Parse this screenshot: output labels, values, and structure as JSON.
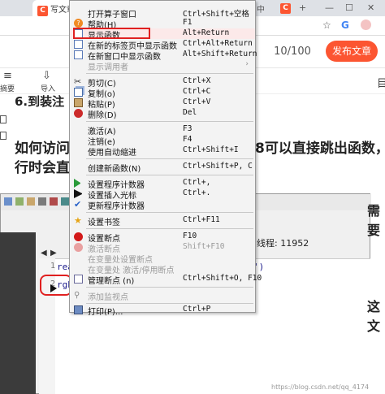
{
  "browser": {
    "tab_title": "写文章-",
    "tab_logo": "C",
    "tab_close": "×",
    "tab_fragment": "中",
    "tab2_logo": "C",
    "new_tab": "+",
    "win_min": "—",
    "win_max": "☐",
    "win_close": "✕",
    "star": "☆"
  },
  "editor": {
    "page_counter": "10/100",
    "publish_label": "发布文章",
    "toolbar_labels": [
      "摘要",
      "导入"
    ],
    "right_label": "目",
    "heading": "6.到装注",
    "paragraph_line1": "如何访问",
    "paragraph_line1_end": "8可以直接跳出函数，",
    "paragraph_line2": "行时会直",
    "edge_text_1": "需要",
    "edge_text_2": "这文"
  },
  "debugger": {
    "thread_label": "线程: 11952",
    "code_line_1": "rea",
    "code_line_1_end": "')",
    "code_line_2": "rgb",
    "line_number_1": "1",
    "line_number_2": "2"
  },
  "context_menu": {
    "items": [
      {
        "label": "打开算子窗口",
        "shortcut": "Ctrl+Shift+空格",
        "icon": "blank-icon",
        "enabled": true
      },
      {
        "label": "帮助(H)",
        "shortcut": "F1",
        "icon": "help-icon",
        "enabled": true
      },
      {
        "label": "显示函数",
        "shortcut": "Alt+Return",
        "icon": "document-icon",
        "enabled": true
      },
      {
        "label": "在新的标签页中显示函数",
        "shortcut": "Ctrl+Alt+Return",
        "icon": "document-icon",
        "enabled": true
      },
      {
        "label": "在新窗口中显示函数",
        "shortcut": "Alt+Shift+Return",
        "icon": "document-icon",
        "enabled": true
      },
      {
        "label": "显示调用者",
        "shortcut": "",
        "icon": "blank-icon",
        "enabled": false,
        "submenu_arrow": "›"
      },
      {
        "label": "剪切(C)",
        "shortcut": "Ctrl+X",
        "icon": "scissors-icon",
        "enabled": true
      },
      {
        "label": "复制(o)",
        "shortcut": "Ctrl+C",
        "icon": "copy-icon",
        "enabled": true
      },
      {
        "label": "粘贴(P)",
        "shortcut": "Ctrl+V",
        "icon": "paste-icon",
        "enabled": true
      },
      {
        "label": "删除(D)",
        "shortcut": "Del",
        "icon": "delete-icon",
        "enabled": true
      },
      {
        "label": "激活(A)",
        "shortcut": "F3",
        "icon": "blank-icon",
        "enabled": true
      },
      {
        "label": "注销(e)",
        "shortcut": "F4",
        "icon": "blank-icon",
        "enabled": true
      },
      {
        "label": "使用自动缩进",
        "shortcut": "Ctrl+Shift+I",
        "icon": "blank-icon",
        "enabled": true
      },
      {
        "label": "创建新函数(N)",
        "shortcut": "Ctrl+Shift+P, C",
        "icon": "blank-icon",
        "enabled": true
      },
      {
        "label": "设置程序计数器",
        "shortcut": "Ctrl+,",
        "icon": "green-arrow-icon",
        "enabled": true
      },
      {
        "label": "设置插入光标",
        "shortcut": "Ctrl+.",
        "icon": "black-arrow-icon",
        "enabled": true
      },
      {
        "label": "更新程序计数器",
        "shortcut": "",
        "icon": "checkmark-icon",
        "enabled": true
      },
      {
        "label": "设置书签",
        "shortcut": "Ctrl+F11",
        "icon": "star-icon",
        "enabled": true
      },
      {
        "label": "设置断点",
        "shortcut": "F10",
        "icon": "breakpoint-icon",
        "enabled": true
      },
      {
        "label": "激活断点",
        "shortcut": "Shift+F10",
        "icon": "breakpoint-disabled-icon",
        "enabled": false
      },
      {
        "label": "在变量处设置断点",
        "shortcut": "",
        "icon": "blank-icon",
        "enabled": false
      },
      {
        "label": "在变量处 激活/停用断点",
        "shortcut": "",
        "icon": "blank-icon",
        "enabled": false
      },
      {
        "label": "管理断点 (n)",
        "shortcut": "Ctrl+Shift+O, F10",
        "icon": "breakpoint-doc-icon",
        "enabled": true
      },
      {
        "label": "添加监视点",
        "shortcut": "",
        "icon": "paperclip-icon",
        "enabled": false
      },
      {
        "label": "打印(P)...",
        "shortcut": "Ctrl+P",
        "icon": "printer-icon",
        "enabled": true
      }
    ]
  },
  "watermark": "https://blog.csdn.net/qq_4174"
}
